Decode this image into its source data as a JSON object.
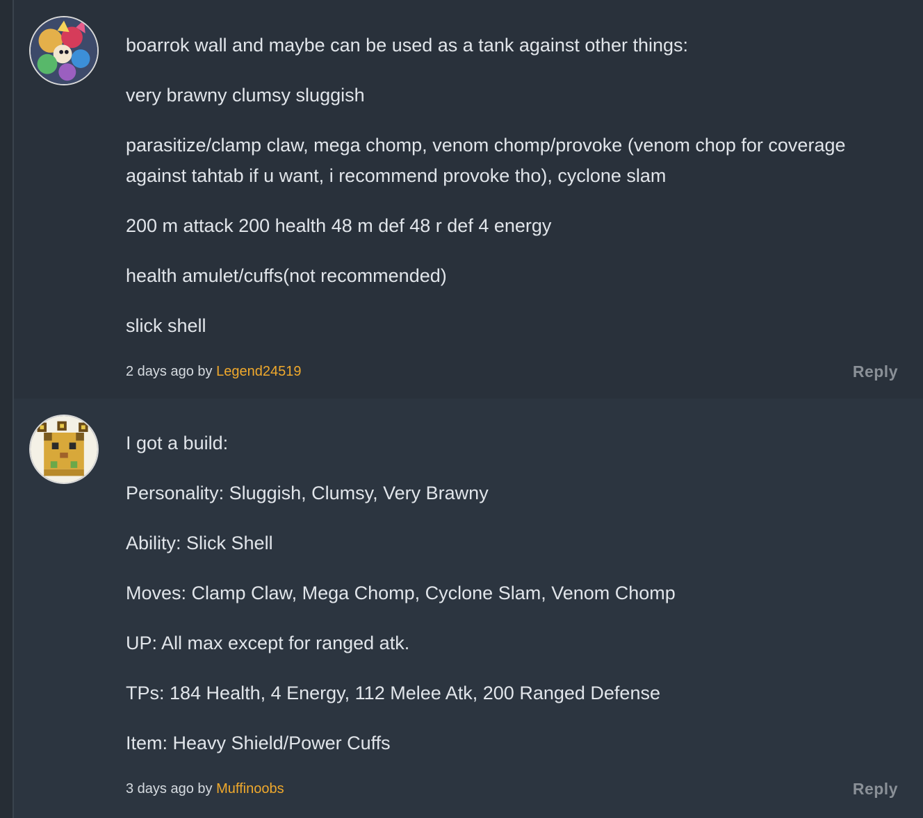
{
  "comments": [
    {
      "paragraphs": [
        "boarrok wall and maybe can be used as a tank against other things:",
        "very brawny clumsy sluggish",
        "parasitize/clamp claw, mega chomp, venom chomp/provoke (venom chop for coverage against tahtab if u want, i recommend provoke tho), cyclone slam",
        "200 m attack 200 health 48 m def 48 r def 4 energy",
        "health amulet/cuffs(not recommended)",
        "slick shell"
      ],
      "time": "2 days ago",
      "by": "by",
      "author": "Legend24519",
      "reply_label": "Reply"
    },
    {
      "paragraphs": [
        "I got a build:",
        "Personality: Sluggish, Clumsy, Very Brawny",
        "Ability: Slick Shell",
        "Moves: Clamp Claw, Mega Chomp, Cyclone Slam, Venom Chomp",
        "UP: All max except for ranged atk.",
        "TPs: 184 Health, 4 Energy, 112 Melee Atk, 200 Ranged Defense",
        "Item: Heavy Shield/Power Cuffs"
      ],
      "time": "3 days ago",
      "by": "by",
      "author": "Muffinoobs",
      "reply_label": "Reply"
    }
  ],
  "colors": {
    "background": "#2b333d",
    "text": "#e1e5ea",
    "author": "#f0a92c",
    "reply": "#8a9097"
  },
  "icons": {
    "avatar_1": "anime-collage-avatar",
    "avatar_2": "pixel-creature-avatar"
  }
}
